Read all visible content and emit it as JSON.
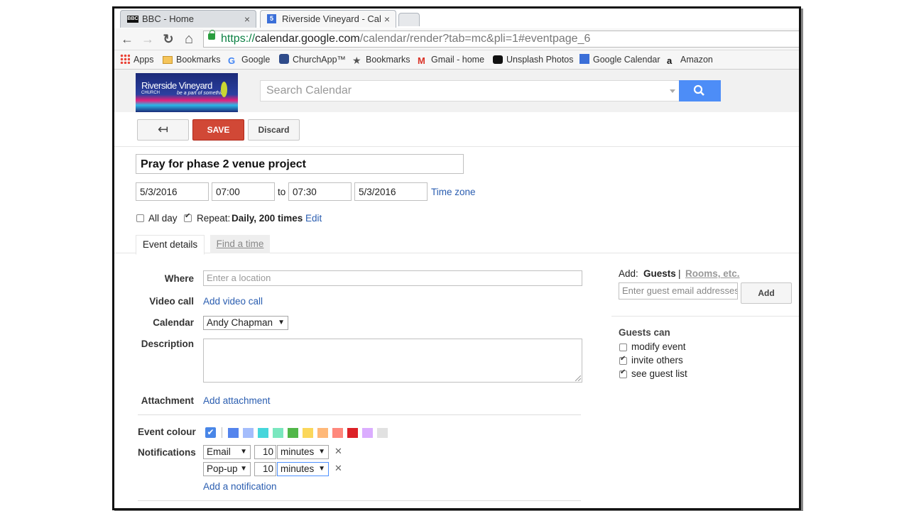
{
  "browser": {
    "tabs": [
      {
        "label": "BBC - Home",
        "favicon": "BBC",
        "close": "×"
      },
      {
        "label": "Riverside Vineyard - Calen",
        "favicon": "5",
        "close": "×"
      }
    ],
    "nav": {
      "back": "←",
      "forward": "→",
      "reload": "↻",
      "home": "⌂"
    },
    "url": {
      "scheme": "https://",
      "host": "calendar.google.com",
      "path": "/calendar/render?tab=mc&pli=1#eventpage_6"
    },
    "bookmarks": [
      "Apps",
      "Bookmarks",
      "Google",
      "ChurchApp™",
      "Bookmarks",
      "Gmail - home",
      "Unsplash Photos",
      "Google Calendar",
      "Amazon"
    ]
  },
  "header": {
    "logo": {
      "line1": "Riverside Vineyard",
      "line2": "CHURCH",
      "tagline": "be a part of something"
    },
    "search_placeholder": "Search Calendar"
  },
  "actions": {
    "back": "↤",
    "save": "SAVE",
    "discard": "Discard"
  },
  "event": {
    "title": "Pray for phase 2 venue project",
    "start_date": "5/3/2016",
    "start_time": "07:00",
    "to": "to",
    "end_time": "07:30",
    "end_date": "5/3/2016",
    "timezone": "Time zone",
    "all_day": "All day",
    "repeat_label": "Repeat:",
    "repeat_value": "Daily, 200 times",
    "edit": "Edit"
  },
  "section_tabs": {
    "details": "Event details",
    "find": "Find a time"
  },
  "details": {
    "where_label": "Where",
    "where_placeholder": "Enter a location",
    "video_label": "Video call",
    "video_link": "Add video call",
    "calendar_label": "Calendar",
    "calendar_value": "Andy Chapman",
    "description_label": "Description",
    "attachment_label": "Attachment",
    "attachment_link": "Add attachment",
    "colour_label": "Event colour",
    "colours": [
      "#5484ed",
      "#a4bdfc",
      "#46d6db",
      "#7ae7bf",
      "#51b749",
      "#fbd75b",
      "#ffb878",
      "#ff887c",
      "#dc2127",
      "#dbadff",
      "#e1e1e1"
    ],
    "notifications_label": "Notifications",
    "notifications": [
      {
        "method": "Email",
        "amount": "10",
        "unit": "minutes"
      },
      {
        "method": "Pop-up",
        "amount": "10",
        "unit": "minutes"
      }
    ],
    "add_notification": "Add a notification"
  },
  "guests": {
    "add_label": "Add:",
    "guests_tab": "Guests",
    "separator": "|",
    "rooms_tab": "Rooms, etc.",
    "email_placeholder": "Enter guest email addresses",
    "add_button": "Add",
    "can_label": "Guests can",
    "permissions": [
      {
        "label": "modify event",
        "checked": false
      },
      {
        "label": "invite others",
        "checked": true
      },
      {
        "label": "see guest list",
        "checked": true
      }
    ]
  }
}
